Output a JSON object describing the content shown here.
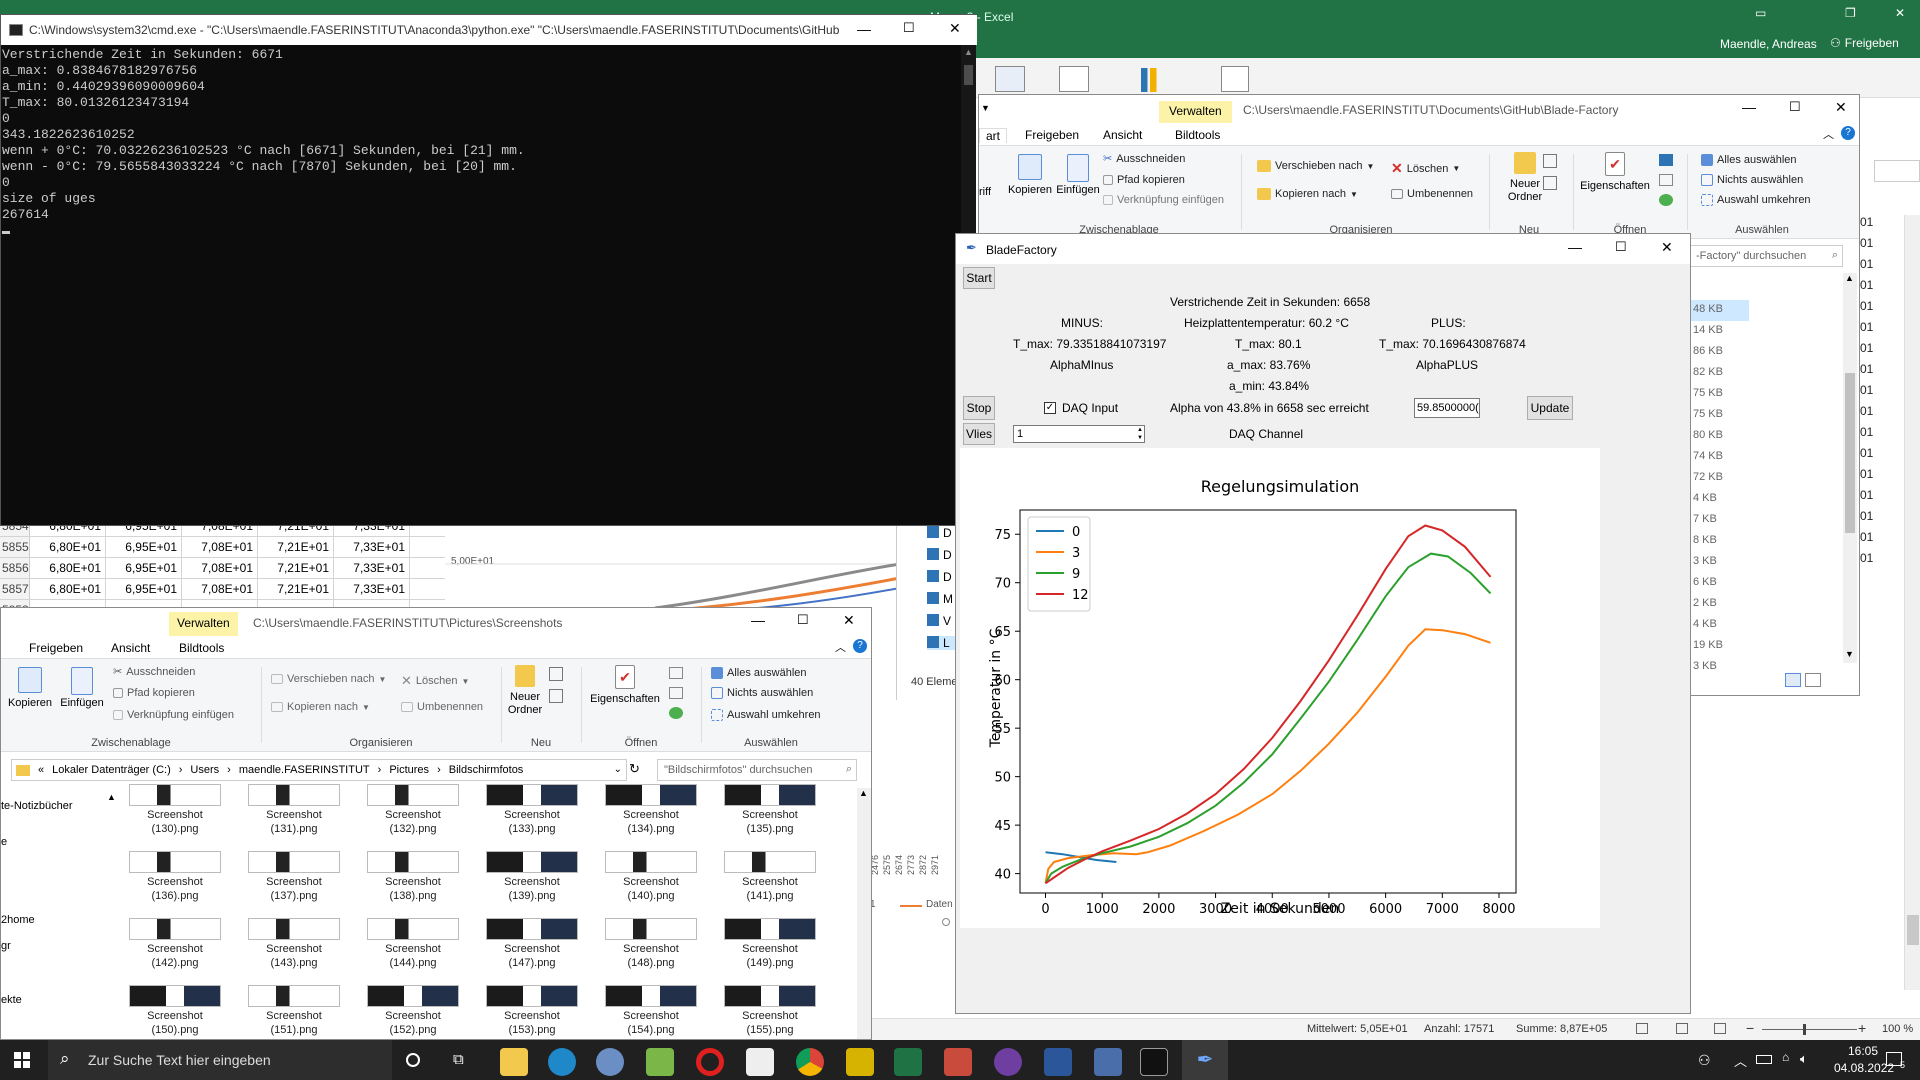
{
  "excel": {
    "title": "Mappe3 - Excel",
    "user": "Maendle, Andreas",
    "share_label": "Freigeben",
    "rows": [
      {
        "num": "5854",
        "cells": [
          "6,80E+01",
          "6,95E+01",
          "7,08E+01",
          "7,21E+01",
          "7,33E+01"
        ]
      },
      {
        "num": "5855",
        "cells": [
          "6,80E+01",
          "6,95E+01",
          "7,08E+01",
          "7,21E+01",
          "7,33E+01"
        ]
      },
      {
        "num": "5856",
        "cells": [
          "6,80E+01",
          "6,95E+01",
          "7,08E+01",
          "7,21E+01",
          "7,33E+01"
        ]
      },
      {
        "num": "5857",
        "cells": [
          "6,80E+01",
          "6,95E+01",
          "7,08E+01",
          "7,21E+01",
          "7,33E+01"
        ]
      },
      {
        "num": "5858",
        "cells": [
          "",
          "",
          "",
          "",
          ""
        ]
      }
    ],
    "chart_axis_label": "5,00E+01",
    "x_ticks": [
      "2476",
      "2575",
      "2674",
      "2773",
      "2872",
      "2971"
    ],
    "legend_fragment_1": "1",
    "legend_fragment_2": "Daten",
    "sizes": [
      "48 KB",
      "14 KB",
      "86 KB",
      "82 KB",
      "75 KB",
      "75 KB",
      "80 KB",
      "74 KB",
      "72 KB",
      "4 KB",
      "7 KB",
      "8 KB",
      "3 KB",
      "6 KB",
      "2 KB",
      "4 KB",
      "19 KB",
      "3 KB"
    ],
    "status": {
      "mean": "Mittelwert: 5,05E+01",
      "count": "Anzahl: 17571",
      "sum": "Summe: 8,87E+05",
      "zoom": "100 %"
    },
    "edge_ones": [
      "01",
      "01",
      "01",
      "01",
      "01",
      "01",
      "01",
      "01",
      "01",
      "01",
      "01",
      "01",
      "01",
      "01",
      "01",
      "01",
      "01"
    ]
  },
  "cmd": {
    "title": "C:\\Windows\\system32\\cmd.exe - \"C:\\Users\\maendle.FASERINSTITUT\\Anaconda3\\python.exe\"  \"C:\\Users\\maendle.FASERINSTITUT\\Documents\\GitHub\\...",
    "lines": [
      "Verstrichende Zeit in Sekunden: 6671",
      "a_max: 0.8384678182976756",
      "a_min: 0.44029396090009604",
      "T_max: 80.01326123473194",
      "0",
      "343.1822623610252",
      "wenn + 0°C: 70.03226236102523 °C nach [6671] Sekunden, bei [21] mm.",
      "wenn - 0°C: 79.5655843033224 °C nach [7870] Sekunden, bei [20] mm.",
      "0",
      "size of uges",
      "267614"
    ]
  },
  "explorer_blade": {
    "title": "C:\\Users\\maendle.FASERINSTITUT\\Documents\\GitHub\\Blade-Factory",
    "manage_label": "Verwalten",
    "tabs": [
      "art",
      "Freigeben",
      "Ansicht",
      "Bildtools"
    ],
    "clip": {
      "partial": "riff",
      "copy": "Kopieren",
      "paste": "Einfügen",
      "cut": "Ausschneiden",
      "copy_path": "Pfad kopieren",
      "paste_link": "Verknüpfung einfügen",
      "group": "Zwischenablage"
    },
    "org": {
      "move": "Verschieben nach",
      "copy_to": "Kopieren nach",
      "delete": "Löschen",
      "rename": "Umbenennen",
      "group": "Organisieren"
    },
    "new": {
      "folder": "Neuer Ordner",
      "group": "Neu"
    },
    "open": {
      "props": "Eigenschaften",
      "group": "Öffnen"
    },
    "select": {
      "all": "Alles auswählen",
      "none": "Nichts auswählen",
      "invert": "Auswahl umkehren",
      "group": "Auswählen"
    },
    "search_placeholder": "-Factory\" durchsuchen"
  },
  "explorer_shots": {
    "title": "C:\\Users\\maendle.FASERINSTITUT\\Pictures\\Screenshots",
    "manage_label": "Verwalten",
    "tabs": [
      "Freigeben",
      "Ansicht",
      "Bildtools"
    ],
    "clip": {
      "copy": "Kopieren",
      "paste": "Einfügen",
      "cut": "Ausschneiden",
      "copy_path": "Pfad kopieren",
      "paste_link": "Verknüpfung einfügen",
      "group": "Zwischenablage"
    },
    "org": {
      "move": "Verschieben nach",
      "copy_to": "Kopieren nach",
      "delete": "Löschen",
      "rename": "Umbenennen",
      "group": "Organisieren"
    },
    "new": {
      "folder": "Neuer Ordner",
      "group": "Neu"
    },
    "open": {
      "props": "Eigenschaften",
      "group": "Öffnen"
    },
    "select": {
      "all": "Alles auswählen",
      "none": "Nichts auswählen",
      "invert": "Auswahl umkehren",
      "group": "Auswählen"
    },
    "breadcrumb": [
      "Lokaler Datenträger (C:)",
      "Users",
      "maendle.FASERINSTITUT",
      "Pictures",
      "Bildschirmfotos"
    ],
    "search_placeholder": "\"Bildschirmfotos\" durchsuchen",
    "nav_items": [
      "te-Notizbücher",
      "e",
      "2home",
      "gr",
      "ekte"
    ],
    "side_list": [
      "D",
      "D",
      "D",
      "M",
      "V",
      "L"
    ],
    "item_count": "40 Eleme",
    "files": [
      [
        "Screenshot",
        "(130).png"
      ],
      [
        "Screenshot",
        "(131).png"
      ],
      [
        "Screenshot",
        "(132).png"
      ],
      [
        "Screenshot",
        "(133).png"
      ],
      [
        "Screenshot",
        "(134).png"
      ],
      [
        "Screenshot",
        "(135).png"
      ],
      [
        "Screenshot",
        "(136).png"
      ],
      [
        "Screenshot",
        "(137).png"
      ],
      [
        "Screenshot",
        "(138).png"
      ],
      [
        "Screenshot",
        "(139).png"
      ],
      [
        "Screenshot",
        "(140).png"
      ],
      [
        "Screenshot",
        "(141).png"
      ],
      [
        "Screenshot",
        "(142).png"
      ],
      [
        "Screenshot",
        "(143).png"
      ],
      [
        "Screenshot",
        "(144).png"
      ],
      [
        "Screenshot",
        "(147).png"
      ],
      [
        "Screenshot",
        "(148).png"
      ],
      [
        "Screenshot",
        "(149).png"
      ],
      [
        "Screenshot",
        "(150).png"
      ],
      [
        "Screenshot",
        "(151).png"
      ],
      [
        "Screenshot",
        "(152).png"
      ],
      [
        "Screenshot",
        "(153).png"
      ],
      [
        "Screenshot",
        "(154).png"
      ],
      [
        "Screenshot",
        "(155).png"
      ]
    ]
  },
  "blade": {
    "title": "BladeFactory",
    "start": "Start",
    "elapsed": "Verstrichende Zeit in Sekunden: 6658",
    "minus": "MINUS:",
    "heat": "Heizplattentemperatur: 60.2 °C",
    "plus": "PLUS:",
    "tmax_minus": "T_max: 79.33518841073197",
    "tmax": "T_max: 80.1",
    "tmax_plus": "T_max: 70.1696430876874",
    "alpha_minus": "AlphaMInus",
    "amax": "a_max: 83.76%",
    "alpha_plus": "AlphaPLUS",
    "amin": "a_min: 43.84%",
    "stop": "Stop",
    "daq_input": "DAQ Input",
    "alpha_reached": "Alpha von 43.8% in 6658 sec erreicht",
    "input_value": "59.8500000(",
    "update": "Update",
    "vlies": "Vlies",
    "spin_value": "1",
    "daq_channel": "DAQ Channel"
  },
  "chart_data": {
    "type": "line",
    "title": "Regelungsimulation",
    "xlabel": "Zeit in Sekunden",
    "ylabel": "Temperatur in °C",
    "xlim": [
      -450,
      8300
    ],
    "ylim": [
      38,
      77.5
    ],
    "xticks": [
      0,
      1000,
      2000,
      3000,
      4000,
      5000,
      6000,
      7000,
      8000
    ],
    "yticks": [
      40,
      45,
      50,
      55,
      60,
      65,
      70,
      75
    ],
    "legend_position": "top-left",
    "series": [
      {
        "name": "0",
        "color": "#1f77b4",
        "points": [
          [
            0,
            42.2
          ],
          [
            300,
            42.0
          ],
          [
            600,
            41.7
          ],
          [
            900,
            41.4
          ],
          [
            1250,
            41.2
          ]
        ]
      },
      {
        "name": "3",
        "color": "#ff7f0e",
        "points": [
          [
            0,
            39.0
          ],
          [
            50,
            40.5
          ],
          [
            150,
            41.2
          ],
          [
            400,
            41.6
          ],
          [
            800,
            41.9
          ],
          [
            1200,
            42.1
          ],
          [
            1600,
            42.0
          ],
          [
            1800,
            42.2
          ],
          [
            2200,
            42.9
          ],
          [
            2800,
            44.4
          ],
          [
            3400,
            46.1
          ],
          [
            4000,
            48.2
          ],
          [
            4500,
            50.6
          ],
          [
            5000,
            53.4
          ],
          [
            5500,
            56.6
          ],
          [
            6000,
            60.3
          ],
          [
            6400,
            63.5
          ],
          [
            6700,
            65.2
          ],
          [
            7000,
            65.1
          ],
          [
            7400,
            64.7
          ],
          [
            7850,
            63.8
          ]
        ]
      },
      {
        "name": "9",
        "color": "#2ca02c",
        "points": [
          [
            0,
            39.0
          ],
          [
            100,
            40.0
          ],
          [
            300,
            40.7
          ],
          [
            600,
            41.4
          ],
          [
            1000,
            42.1
          ],
          [
            1500,
            42.8
          ],
          [
            2000,
            43.8
          ],
          [
            2500,
            45.2
          ],
          [
            3000,
            47.0
          ],
          [
            3500,
            49.4
          ],
          [
            4000,
            52.3
          ],
          [
            4500,
            56.0
          ],
          [
            5000,
            59.8
          ],
          [
            5500,
            64.1
          ],
          [
            6000,
            68.6
          ],
          [
            6400,
            71.6
          ],
          [
            6800,
            73.0
          ],
          [
            7100,
            72.7
          ],
          [
            7500,
            71.0
          ],
          [
            7850,
            68.9
          ]
        ]
      },
      {
        "name": "12",
        "color": "#d62728",
        "points": [
          [
            0,
            39.0
          ],
          [
            150,
            39.6
          ],
          [
            400,
            40.6
          ],
          [
            700,
            41.5
          ],
          [
            1000,
            42.3
          ],
          [
            1500,
            43.4
          ],
          [
            2000,
            44.6
          ],
          [
            2500,
            46.2
          ],
          [
            3000,
            48.2
          ],
          [
            3500,
            50.8
          ],
          [
            4000,
            54.0
          ],
          [
            4500,
            57.8
          ],
          [
            5000,
            62.0
          ],
          [
            5500,
            66.6
          ],
          [
            6000,
            71.4
          ],
          [
            6400,
            74.8
          ],
          [
            6700,
            75.9
          ],
          [
            7000,
            75.4
          ],
          [
            7400,
            73.7
          ],
          [
            7850,
            70.6
          ]
        ]
      }
    ]
  },
  "taskbar": {
    "search_placeholder": "Zur Suche Text hier eingeben",
    "time": "16:05",
    "date": "04.08.2022",
    "notif_count": "5"
  }
}
